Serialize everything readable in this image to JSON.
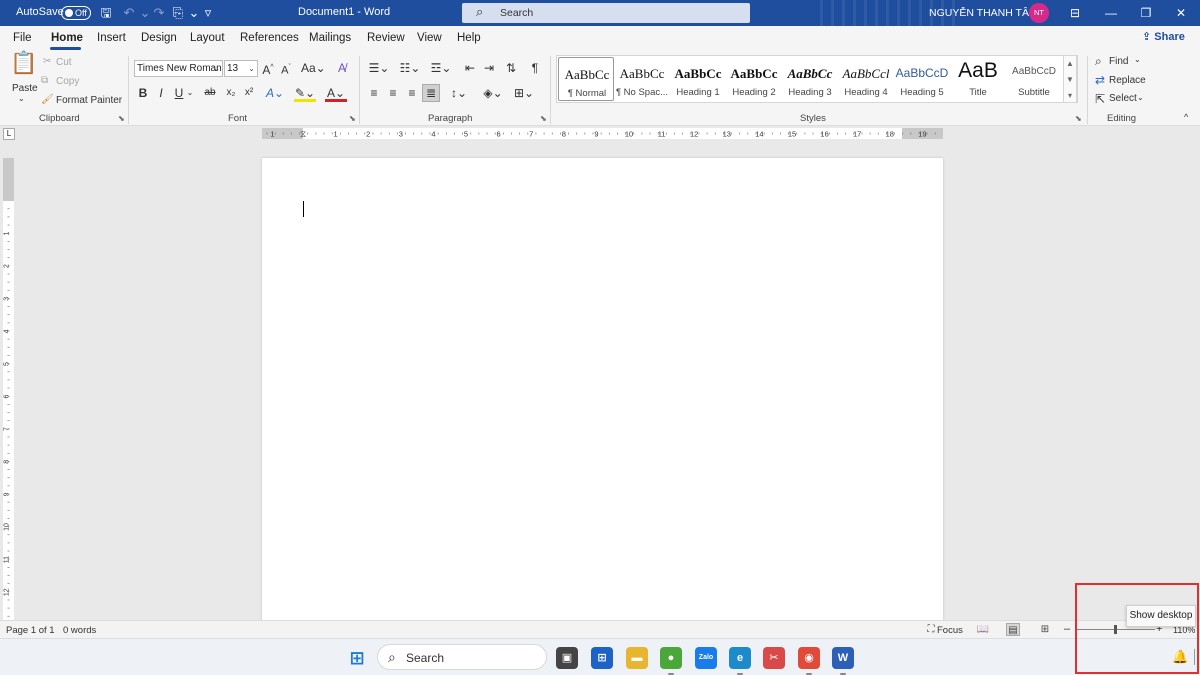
{
  "titlebar": {
    "autosave_label": "AutoSave",
    "autosave_state": "Off",
    "doc_title": "Document1  -  Word",
    "search_placeholder": "Search",
    "user_name": "NGUYỄN THANH TÂM",
    "avatar_initials": "NT",
    "icons": [
      "save-icon",
      "undo-icon",
      "redo-icon",
      "new-file-icon",
      "customize-icon"
    ]
  },
  "menu": {
    "tabs": [
      "File",
      "Home",
      "Insert",
      "Design",
      "Layout",
      "References",
      "Mailings",
      "Review",
      "View",
      "Help"
    ],
    "active": "Home",
    "share_label": "Share"
  },
  "ribbon": {
    "clipboard": {
      "paste": "Paste",
      "cut": "Cut",
      "copy": "Copy",
      "format_painter": "Format Painter",
      "label": "Clipboard"
    },
    "font": {
      "name": "Times New Roman",
      "size": "13",
      "label": "Font",
      "grow": "A^",
      "shrink": "A^",
      "case": "Aa"
    },
    "paragraph": {
      "label": "Paragraph"
    },
    "styles": {
      "label": "Styles",
      "items": [
        {
          "sample": "AaBbCc",
          "name": "¶ Normal"
        },
        {
          "sample": "AaBbCc",
          "name": "¶ No Spac..."
        },
        {
          "sample": "AaBbCc",
          "name": "Heading 1"
        },
        {
          "sample": "AaBbCc",
          "name": "Heading 2"
        },
        {
          "sample": "AaBbCc",
          "name": "Heading 3"
        },
        {
          "sample": "AaBbCcl",
          "name": "Heading 4"
        },
        {
          "sample": "AaBbCcD",
          "name": "Heading 5"
        },
        {
          "sample": "AaB",
          "name": "Title"
        },
        {
          "sample": "AaBbCcD",
          "name": "Subtitle"
        }
      ]
    },
    "editing": {
      "find": "Find",
      "replace": "Replace",
      "select": "Select",
      "label": "Editing"
    }
  },
  "ruler": {
    "h_labels": [
      "1",
      "1",
      "2",
      "3",
      "4",
      "5",
      "6",
      "7",
      "8",
      "9",
      "10",
      "11",
      "12",
      "13",
      "14",
      "15",
      "16",
      "17",
      "18",
      "19"
    ],
    "v_labels": [
      "1",
      "1",
      "2",
      "3",
      "4",
      "5",
      "6",
      "7",
      "8",
      "9",
      "10",
      "11",
      "12"
    ]
  },
  "status": {
    "page": "Page 1 of 1",
    "words": "0 words",
    "focus": "Focus",
    "zoom": "110%",
    "zoom_minus": "–",
    "zoom_plus": "+"
  },
  "taskbar": {
    "search_label": "Search",
    "apps": [
      {
        "name": "task-view",
        "glyph": "▣",
        "color": "#444444"
      },
      {
        "name": "microsoft-store",
        "glyph": "⊞",
        "color": "#1d63c7"
      },
      {
        "name": "file-explorer",
        "glyph": "▬",
        "color": "#e8b530"
      },
      {
        "name": "coccoc",
        "glyph": "●",
        "color": "#4aa83a"
      },
      {
        "name": "zalo",
        "glyph": "Zalo",
        "color": "#1a7bea"
      },
      {
        "name": "edge",
        "glyph": "e",
        "color": "#1d8acb"
      },
      {
        "name": "snip",
        "glyph": "✂",
        "color": "#d84a4a"
      },
      {
        "name": "chrome",
        "glyph": "◉",
        "color": "#e04a3a"
      },
      {
        "name": "word",
        "glyph": "W",
        "color": "#2b5fb8"
      }
    ]
  },
  "tooltip": "Show desktop",
  "colors": {
    "title_bar": "#1f4e9e",
    "avatar": "#d62a8a",
    "highlight": "#e03030"
  }
}
